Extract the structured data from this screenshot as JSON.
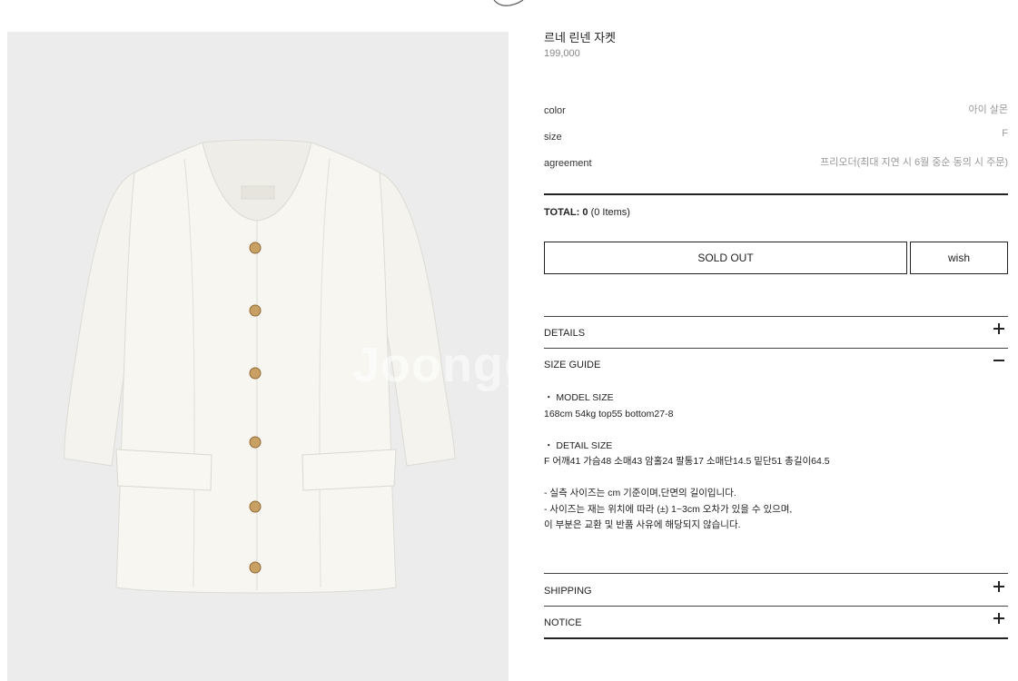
{
  "product": {
    "name": "르네 린넨 자켓",
    "price": "199,000",
    "image_alt": "white linen jacket",
    "watermark": "Joongg"
  },
  "options": [
    {
      "label": "color",
      "value": "아이  살몬"
    },
    {
      "label": "size",
      "value": "F"
    },
    {
      "label": "agreement",
      "value": "프리오더(최대 지연 시 6월 중순 동의 시 주문)"
    }
  ],
  "total": {
    "label": "TOTAL:",
    "amount": "0",
    "items": "(0 Items)"
  },
  "buttons": {
    "sold_out": "SOLD OUT",
    "wish": "wish"
  },
  "accordion": [
    {
      "title": "DETAILS",
      "icon": "plus-icon",
      "expanded": false
    },
    {
      "title": "SIZE GUIDE",
      "icon": "minus-icon",
      "expanded": true
    },
    {
      "title": "SHIPPING",
      "icon": "plus-icon",
      "expanded": false
    },
    {
      "title": "NOTICE",
      "icon": "plus-icon",
      "expanded": false
    }
  ],
  "size_guide": {
    "model_heading": "・ MODEL SIZE",
    "model_text": "168cm 54kg top55 bottom27-8",
    "detail_heading": "・ DETAIL SIZE",
    "detail_text": "F 어깨41 가슴48 소매43 암홀24 팔통17 소매단14.5 밑단51 총길이64.5",
    "note_1": "- 실측 사이즈는 cm 기준이며,단면의 길이입니다.",
    "note_2": "- 사이즈는 재는 위치에 따라 (±) 1~3cm 오차가 있을 수 있으며,",
    "note_3": "이 부분은 교환 및 반품 사유에 해당되지 않습니다."
  },
  "colors": {
    "image_bg": "#ececec",
    "jacket": "#f6f5f0",
    "button_gold": "#c9a064",
    "border": "#222222",
    "muted_text": "#999999"
  }
}
